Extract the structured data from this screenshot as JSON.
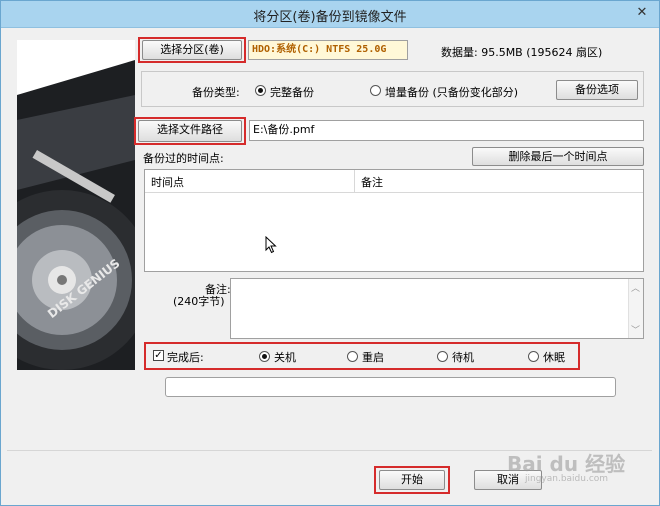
{
  "window": {
    "title": "将分区(卷)备份到镜像文件",
    "close_glyph": "✕"
  },
  "branding": {
    "disk_genius_text": "DISK GENIUS"
  },
  "partition": {
    "select_button": "选择分区(卷)",
    "selected_value": "HDO:系统(C:) NTFS 25.0G",
    "data_amount": "数据量: 95.5MB (195624 扇区)"
  },
  "backup_type": {
    "label": "备份类型:",
    "options": [
      "完整备份",
      "增量备份 (只备份变化部分)"
    ],
    "selected_index": 0,
    "options_button": "备份选项"
  },
  "file_path": {
    "select_button": "选择文件路径",
    "value": "E:\\备份.pmf"
  },
  "timepoints": {
    "label": "备份过的时间点:",
    "delete_last_button": "删除最后一个时间点",
    "columns": [
      "时间点",
      "备注"
    ],
    "rows": []
  },
  "note": {
    "label": "备注:",
    "sublabel": "(240字节)",
    "value": ""
  },
  "after_complete": {
    "label": "完成后:",
    "checked": true,
    "options": [
      "关机",
      "重启",
      "待机",
      "休眠"
    ],
    "selected_index": 0
  },
  "progress": {
    "value": 0
  },
  "footer": {
    "start_button": "开始",
    "cancel_button": "取消"
  },
  "watermark": {
    "text": "Bai du 经验",
    "sub": "jingyan.baidu.com"
  }
}
